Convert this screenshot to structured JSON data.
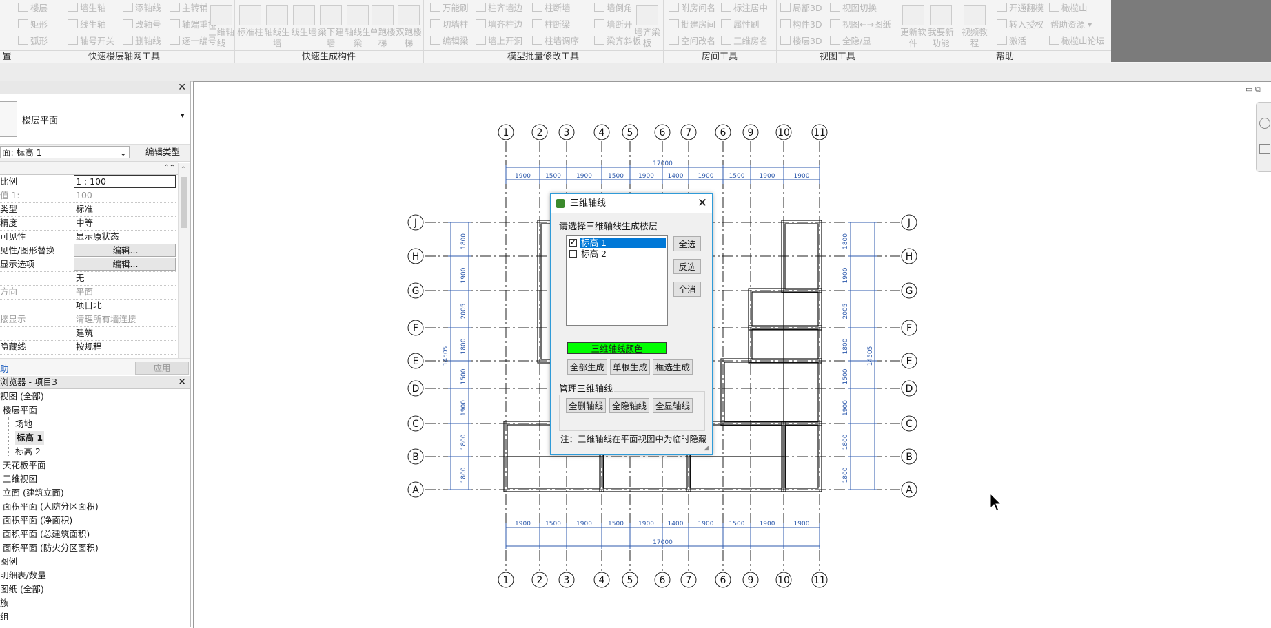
{
  "ribbon": {
    "groups": [
      {
        "title": "快速楼层轴网工具",
        "items": [
          "楼层",
          "矩形",
          "弧形",
          "墙生轴",
          "线生轴",
          "轴号开关",
          "添轴线",
          "改轴号",
          "删轴线",
          "主转辅",
          "轴端重排",
          "逐一编号"
        ],
        "big": [
          "三维轴线"
        ]
      },
      {
        "title": "快速生成构件",
        "items": [],
        "big": [
          "标准柱",
          "轴线生墙",
          "线生墙",
          "梁下建墙",
          "轴线生梁",
          "单跑楼梯",
          "双跑楼梯"
        ]
      },
      {
        "title": "模型批量修改工具",
        "items": [
          "万能刷",
          "切墙柱",
          "编辑梁",
          "柱齐墙边",
          "墙齐柱边",
          "墙上开洞",
          "柱断墙",
          "柱断梁",
          "柱墙调序",
          "墙倒角",
          "墙断开",
          "梁齐斜板"
        ],
        "big": [
          "墙齐梁板"
        ]
      },
      {
        "title": "房间工具",
        "items": [
          "附房间名",
          "批建房间",
          "空间改名",
          "标注居中",
          "属性刷",
          "三维房名"
        ],
        "big": []
      },
      {
        "title": "视图工具",
        "items": [
          "局部3D",
          "构件3D",
          "楼层3D",
          "视图切换",
          "视图←→图纸",
          "全隐/显"
        ],
        "big": []
      },
      {
        "title": "帮助",
        "items": [
          "开通翻模",
          "转入授权",
          "激活",
          "橄榄山",
          "帮助资源",
          "橄榄山论坛"
        ],
        "big": [
          "更新软件",
          "我要新功能",
          "视频教程"
        ]
      }
    ],
    "left_partial_title": "置"
  },
  "properties": {
    "type_name": "楼层平面",
    "instance_selector": "楼层平面: 标高 1",
    "instance_selector_visible": "面: 标高 1",
    "edit_type_label": "编辑类型",
    "rows": [
      {
        "k": "比例",
        "v": "1 : 100",
        "boxed": true
      },
      {
        "k": "值 1:",
        "v": "100",
        "gray": true
      },
      {
        "k": "类型",
        "v": "标准"
      },
      {
        "k": "精度",
        "v": "中等"
      },
      {
        "k": "可见性",
        "v": "显示原状态"
      },
      {
        "k": "见性/图形替换",
        "v": "编辑...",
        "button": true
      },
      {
        "k": "显示选项",
        "v": "编辑...",
        "button": true
      },
      {
        "k": "",
        "v": "无"
      },
      {
        "k": "方向",
        "v": "平面",
        "gray": true
      },
      {
        "k": "",
        "v": "项目北"
      },
      {
        "k": "接显示",
        "v": "清理所有墙连接",
        "gray": true
      },
      {
        "k": "",
        "v": "建筑"
      },
      {
        "k": "隐藏线",
        "v": "按规程"
      }
    ],
    "help_link": "助",
    "apply_label": "应用"
  },
  "browser": {
    "title": "浏览器 - 项目3",
    "items": [
      {
        "text": "视图 (全部)",
        "indent": 0
      },
      {
        "text": "楼层平面",
        "indent": 1
      },
      {
        "text": "场地",
        "indent": 2
      },
      {
        "text": "标高 1",
        "indent": 2,
        "bold": true
      },
      {
        "text": "标高 2",
        "indent": 2
      },
      {
        "text": "天花板平面",
        "indent": 1
      },
      {
        "text": "三维视图",
        "indent": 1
      },
      {
        "text": "立面 (建筑立面)",
        "indent": 1
      },
      {
        "text": "面积平面 (人防分区面积)",
        "indent": 1
      },
      {
        "text": "面积平面 (净面积)",
        "indent": 1
      },
      {
        "text": "面积平面 (总建筑面积)",
        "indent": 1
      },
      {
        "text": "面积平面 (防火分区面积)",
        "indent": 1
      },
      {
        "text": "图例",
        "indent": 0
      },
      {
        "text": "明细表/数量",
        "indent": 0
      },
      {
        "text": "图纸 (全部)",
        "indent": 0
      },
      {
        "text": "族",
        "indent": 0
      },
      {
        "text": "组",
        "indent": 0
      }
    ]
  },
  "drawing": {
    "vertical_axes": [
      "1",
      "2",
      "3",
      "4",
      "5",
      "6",
      "7",
      "6",
      "9",
      "10",
      "11"
    ],
    "horizontal_axes": [
      "J",
      "H",
      "G",
      "F",
      "E",
      "D",
      "C",
      "B",
      "A"
    ],
    "top_dimensions": [
      "1900",
      "1500",
      "1900",
      "1500",
      "1900",
      "1400",
      "1900",
      "1500",
      "1900",
      "1900"
    ],
    "bottom_dimensions": [
      "1900",
      "1500",
      "1900",
      "1500",
      "1900",
      "1400",
      "1900",
      "1500",
      "1900",
      "1900"
    ],
    "total_width": "17000",
    "side_dimensions": [
      "1800",
      "1900",
      "2005",
      "1800",
      "1500",
      "1900",
      "1800",
      "1800"
    ],
    "total_height": "14505",
    "line_color": "#2e5aac",
    "wall_color": "#111111"
  },
  "dialog": {
    "title": "三维轴线",
    "prompt": "请选择三维轴线生成楼层",
    "levels": [
      {
        "name": "标高 1",
        "checked": true,
        "selected": true
      },
      {
        "name": "标高 2",
        "checked": false,
        "selected": false
      }
    ],
    "select_all": "全选",
    "invert": "反选",
    "clear_all": "全消",
    "color_button": "三维轴线颜色",
    "color_value": "#00ff00",
    "gen_all": "全部生成",
    "gen_single": "单根生成",
    "gen_box": "框选生成",
    "manage_label": "管理三维轴线",
    "del_all": "全删轴线",
    "hide_all": "全隐轴线",
    "show_all": "全显轴线",
    "note": "注：三维轴线在平面视图中为临时隐藏"
  }
}
